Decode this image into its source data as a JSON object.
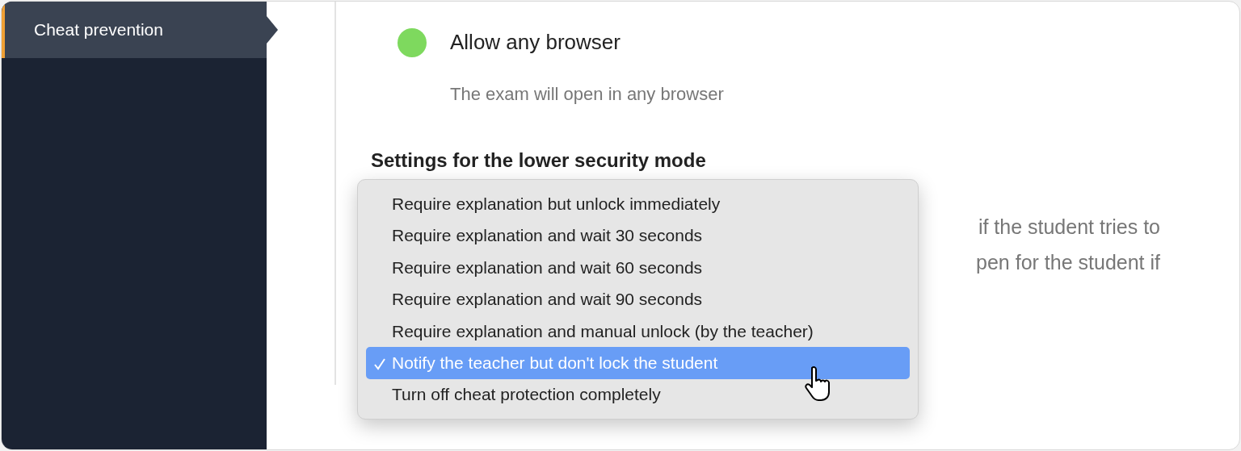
{
  "sidebar": {
    "items": [
      {
        "label": "Cheat prevention",
        "selected": true
      }
    ]
  },
  "option": {
    "title": "Allow any browser",
    "description": "The exam will open in any browser",
    "color": "#7ed95e"
  },
  "section": {
    "heading": "Settings for the lower security mode",
    "text_lines": [
      "if the student tries to",
      "pen for the student if"
    ]
  },
  "menu": {
    "items": [
      {
        "label": "Require explanation but unlock immediately",
        "selected": false
      },
      {
        "label": "Require explanation and wait 30 seconds",
        "selected": false
      },
      {
        "label": "Require explanation and wait 60 seconds",
        "selected": false
      },
      {
        "label": "Require explanation and wait 90 seconds",
        "selected": false
      },
      {
        "label": "Require explanation and manual unlock (by the teacher)",
        "selected": false
      },
      {
        "label": "Notify the teacher but don't lock the student",
        "selected": true
      },
      {
        "label": "Turn off cheat protection completely",
        "selected": false
      }
    ]
  }
}
